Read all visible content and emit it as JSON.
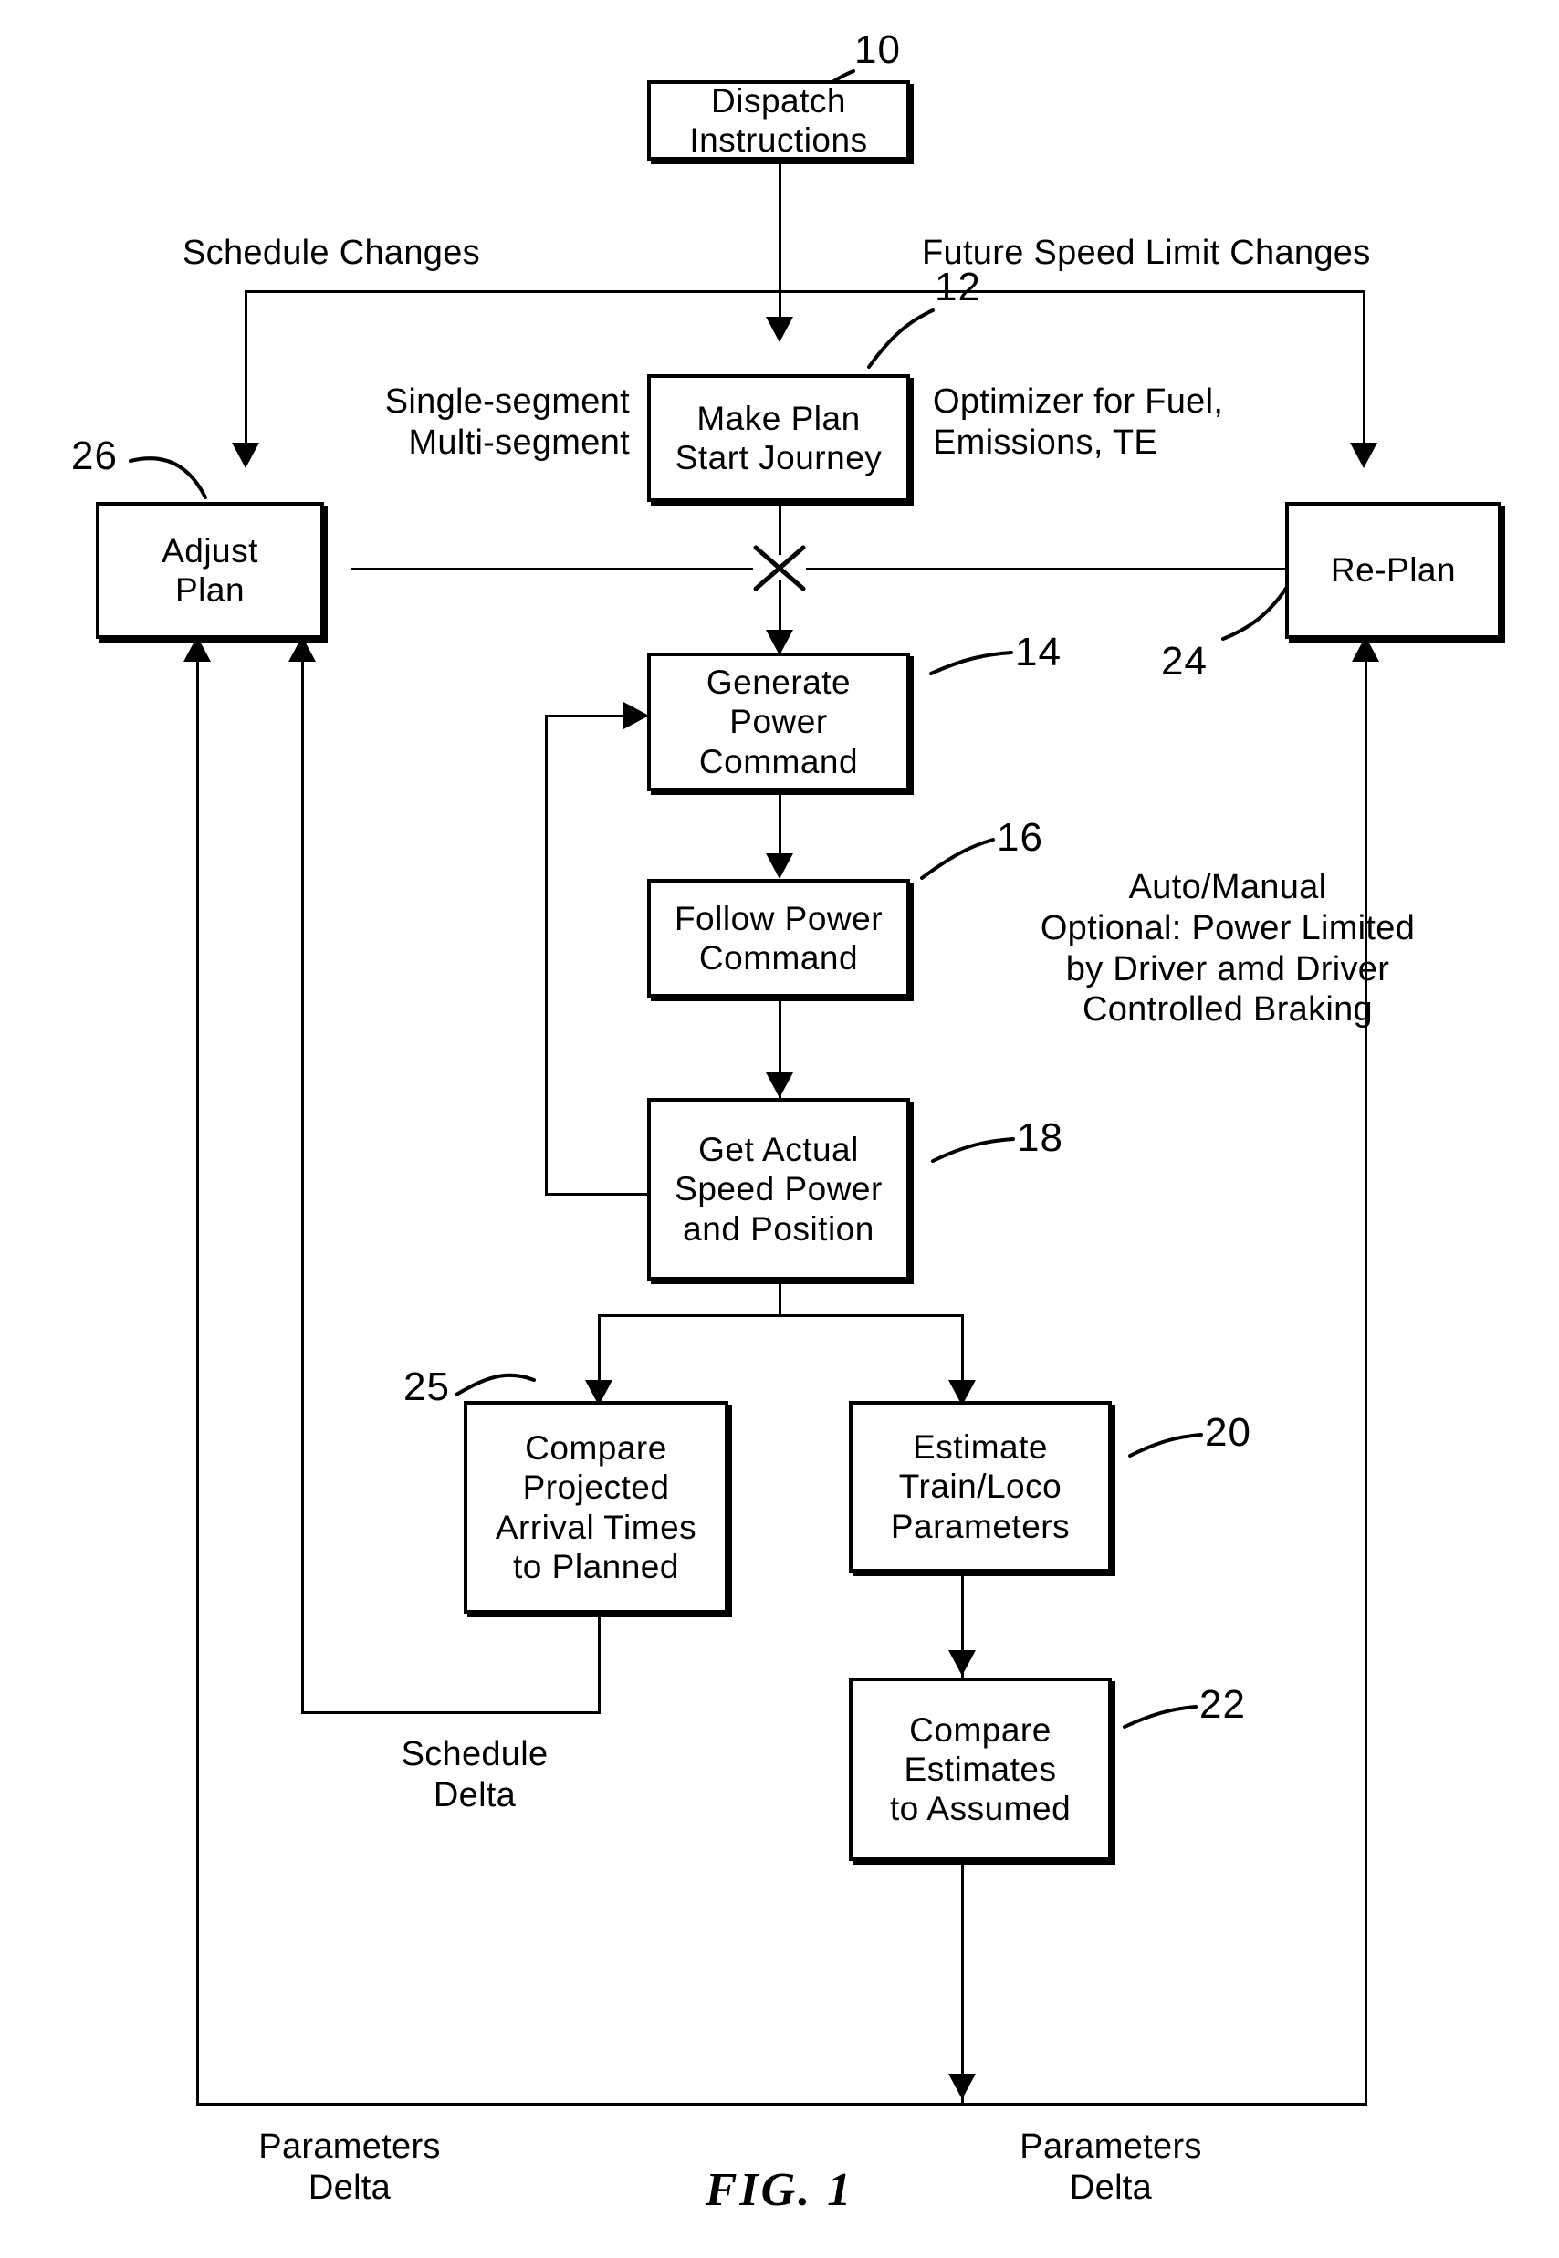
{
  "figure": {
    "caption": "FIG.  1",
    "type": "flowchart",
    "title": "Train trip optimizer planning and re-planning flow"
  },
  "nodes": [
    {
      "id": "10",
      "numeral": "10",
      "lines": [
        "Dispatch",
        "Instructions"
      ],
      "text": "Dispatch Instructions"
    },
    {
      "id": "12",
      "numeral": "12",
      "lines": [
        "Make Plan",
        "Start Journey"
      ],
      "text": "Make Plan Start Journey"
    },
    {
      "id": "26",
      "numeral": "26",
      "lines": [
        "Adjust",
        "Plan"
      ],
      "text": "Adjust Plan"
    },
    {
      "id": "24",
      "numeral": "24",
      "lines": [
        "Re-Plan"
      ],
      "text": "Re-Plan"
    },
    {
      "id": "14",
      "numeral": "14",
      "lines": [
        "Generate",
        "Power",
        "Command"
      ],
      "text": "Generate Power Command"
    },
    {
      "id": "16",
      "numeral": "16",
      "lines": [
        "Follow Power",
        "Command"
      ],
      "text": "Follow Power Command"
    },
    {
      "id": "18",
      "numeral": "18",
      "lines": [
        "Get Actual",
        "Speed Power",
        "and Position"
      ],
      "text": "Get Actual Speed Power and Position"
    },
    {
      "id": "25",
      "numeral": "25",
      "lines": [
        "Compare",
        "Projected",
        "Arrival Times",
        "to Planned"
      ],
      "text": "Compare Projected Arrival Times to Planned"
    },
    {
      "id": "20",
      "numeral": "20",
      "lines": [
        "Estimate",
        "Train/Loco",
        "Parameters"
      ],
      "text": "Estimate Train/Loco Parameters"
    },
    {
      "id": "22",
      "numeral": "22",
      "lines": [
        "Compare",
        "Estimates",
        "to Assumed"
      ],
      "text": "Compare Estimates to Assumed"
    }
  ],
  "annotations": {
    "schedule_changes": "Schedule Changes",
    "future_speed_limit_changes": "Future Speed Limit Changes",
    "segment_modes": "Single-segment\nMulti-segment",
    "optimizer": "Optimizer for Fuel,\nEmissions, TE",
    "auto_manual": "Auto/Manual\nOptional: Power Limited\nby Driver amd Driver\nControlled Braking",
    "schedule_delta": "Schedule\nDelta",
    "parameters_delta_left": "Parameters\nDelta",
    "parameters_delta_right": "Parameters\nDelta"
  },
  "numerals": {
    "n10": "10",
    "n12": "12",
    "n14": "14",
    "n16": "16",
    "n18": "18",
    "n20": "20",
    "n22": "22",
    "n24": "24",
    "n25": "25",
    "n26": "26"
  },
  "colors": {
    "ink": "#000000",
    "paper": "#ffffff"
  }
}
